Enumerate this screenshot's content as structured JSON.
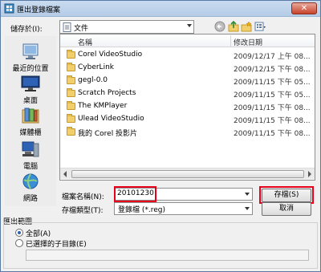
{
  "window": {
    "title": "匯出登錄檔案",
    "close": "✕"
  },
  "location": {
    "label": "儲存於(I):",
    "value": "文件"
  },
  "places": [
    {
      "label": "最近的位置"
    },
    {
      "label": "桌面"
    },
    {
      "label": "媒體櫃"
    },
    {
      "label": "電腦"
    },
    {
      "label": "網路"
    }
  ],
  "list": {
    "columns": [
      "名稱",
      "修改日期"
    ],
    "rows": [
      {
        "name": "Corel VideoStudio",
        "date": "2009/12/17 上午 08..."
      },
      {
        "name": "CyberLink",
        "date": "2009/12/15 下午 08..."
      },
      {
        "name": "gegl-0.0",
        "date": "2009/11/15 下午 05..."
      },
      {
        "name": "Scratch Projects",
        "date": "2009/11/15 下午 05..."
      },
      {
        "name": "The KMPlayer",
        "date": "2009/11/15 下午 08..."
      },
      {
        "name": "Ulead VideoStudio",
        "date": "2009/11/15 下午 08..."
      },
      {
        "name": "我的 Corel 投影片",
        "date": "2009/11/15 下午 08..."
      }
    ]
  },
  "filename": {
    "label": "檔案名稱(N):",
    "value": "20101230"
  },
  "filetype": {
    "label": "存檔類型(T):",
    "value": "登錄檔 (*.reg)"
  },
  "buttons": {
    "save": "存檔(S)",
    "cancel": "取消"
  },
  "export_range": {
    "title": "匯出範圍",
    "all": "全部(A)",
    "selected": "已選擇的子目錄(E)"
  },
  "colors": {
    "highlight": "#e8001a",
    "folder": "#f2cf6b"
  }
}
